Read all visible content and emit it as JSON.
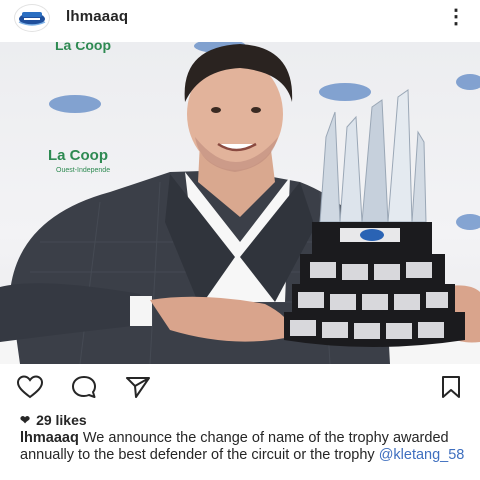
{
  "post": {
    "username": "lhmaaaq",
    "more_icon": "more-dots-icon",
    "likes_count": "29 likes",
    "caption_username": "lhmaaaq",
    "caption_text": " We announce the change of name of the trophy awarded annually to the best defender of the circuit or the trophy ",
    "caption_mention": "@kletang_58"
  },
  "photo": {
    "sponsor_text": "La Coop",
    "sponsor_subtext": "Ouest-Independe"
  },
  "actions": {
    "like_icon": "heart-outline-icon",
    "comment_icon": "comment-icon",
    "share_icon": "share-icon",
    "save_icon": "bookmark-icon"
  },
  "colors": {
    "text": "#262626",
    "mention": "#3f6fbf",
    "backdrop": "#ececef",
    "jacket": "#3b3f48",
    "trophy_base": "#1b1b1e"
  }
}
